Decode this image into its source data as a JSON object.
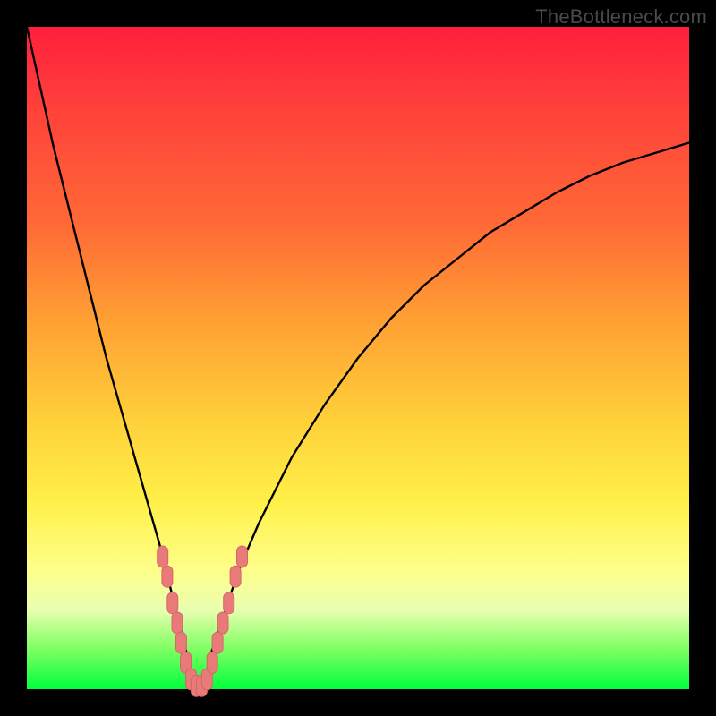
{
  "watermark": "TheBottleneck.com",
  "colors": {
    "frame": "#000000",
    "curve": "#000000",
    "marker_fill": "#e87a7a",
    "marker_stroke": "#d76565"
  },
  "chart_data": {
    "type": "line",
    "title": "",
    "xlabel": "",
    "ylabel": "",
    "xlim": [
      0,
      100
    ],
    "ylim": [
      0,
      100
    ],
    "grid": false,
    "series": [
      {
        "name": "bottleneck-curve",
        "x": [
          0,
          2,
          4,
          6,
          8,
          10,
          12,
          14,
          16,
          18,
          20,
          22,
          23,
          24,
          25,
          26,
          27,
          28,
          30,
          32,
          35,
          40,
          45,
          50,
          55,
          60,
          65,
          70,
          75,
          80,
          85,
          90,
          95,
          100
        ],
        "y": [
          100,
          91,
          82,
          74,
          66,
          58,
          50,
          43,
          36,
          29,
          22,
          14,
          10,
          6,
          2,
          0,
          2,
          6,
          12,
          18,
          25,
          35,
          43,
          50,
          56,
          61,
          65,
          69,
          72,
          75,
          77.5,
          79.5,
          81,
          82.5
        ]
      }
    ],
    "markers": {
      "name": "highlighted-range",
      "points": [
        {
          "x": 20.5,
          "y": 20
        },
        {
          "x": 21.2,
          "y": 17
        },
        {
          "x": 22.0,
          "y": 13
        },
        {
          "x": 22.7,
          "y": 10
        },
        {
          "x": 23.3,
          "y": 7
        },
        {
          "x": 24.0,
          "y": 4
        },
        {
          "x": 24.8,
          "y": 1.5
        },
        {
          "x": 25.6,
          "y": 0.5
        },
        {
          "x": 26.4,
          "y": 0.5
        },
        {
          "x": 27.2,
          "y": 1.5
        },
        {
          "x": 28.0,
          "y": 4
        },
        {
          "x": 28.8,
          "y": 7
        },
        {
          "x": 29.6,
          "y": 10
        },
        {
          "x": 30.5,
          "y": 13
        },
        {
          "x": 31.5,
          "y": 17
        },
        {
          "x": 32.5,
          "y": 20
        }
      ]
    }
  }
}
